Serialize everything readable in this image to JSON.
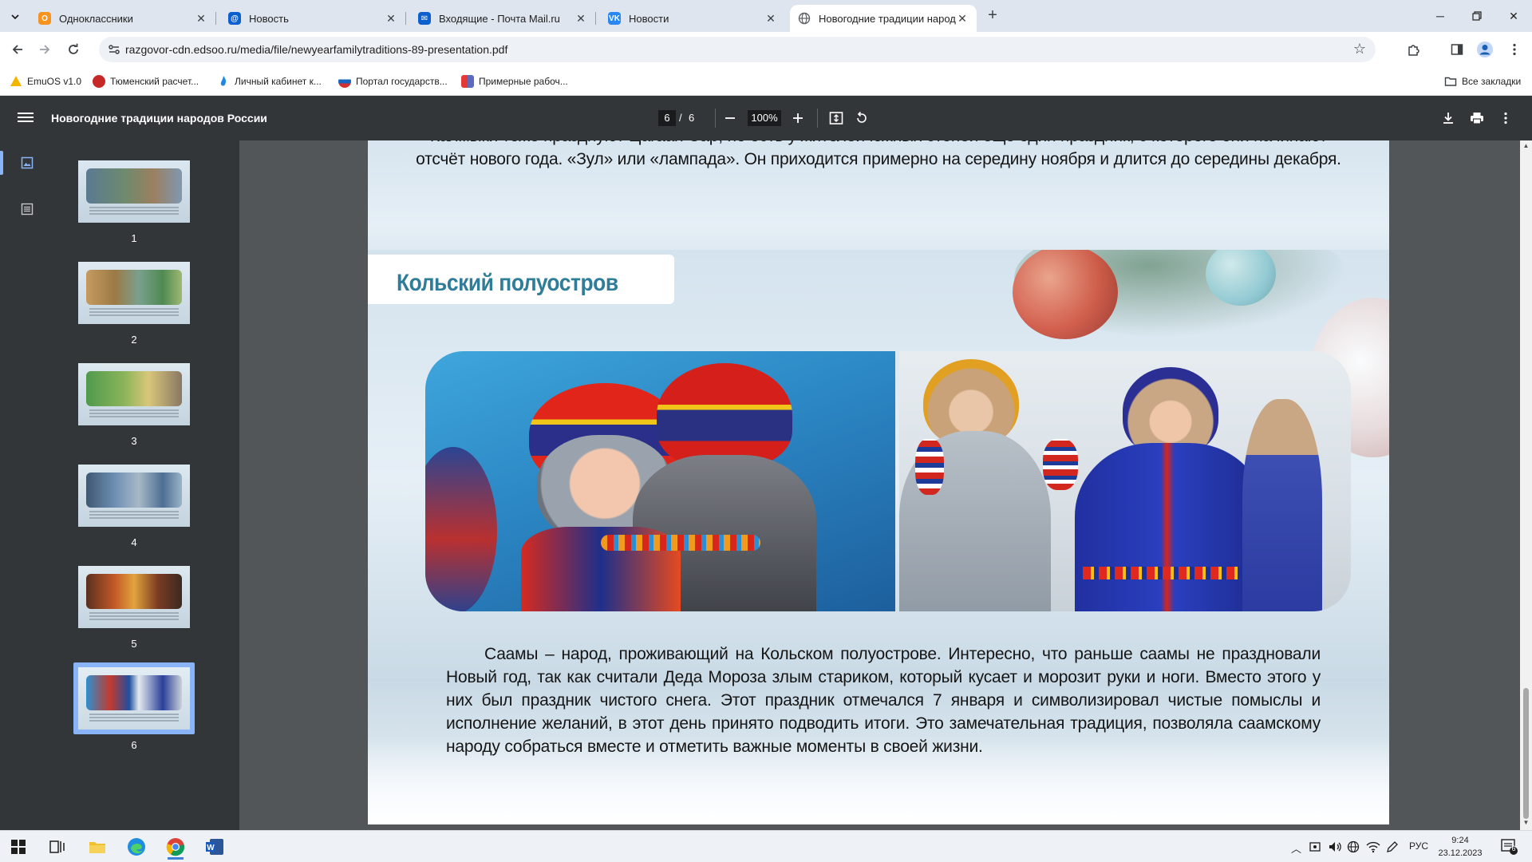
{
  "browser": {
    "tabs": [
      {
        "title": "Одноклассники",
        "favicon": "odnoklassniki-icon",
        "color": "#f7931e",
        "active": false
      },
      {
        "title": "Новость",
        "favicon": "mail-at-icon",
        "color": "#0b5fce",
        "active": false
      },
      {
        "title": "Входящие - Почта Mail.ru",
        "favicon": "mail-envelope-icon",
        "color": "#0b5fce",
        "active": false
      },
      {
        "title": "Новости",
        "favicon": "vk-icon",
        "color": "#2787f5",
        "active": false
      },
      {
        "title": "Новогодние традиции народо",
        "favicon": "globe-icon",
        "color": "#5f6368",
        "active": true
      }
    ],
    "url": "razgovor-cdn.edsoo.ru/media/file/newyearfamilytraditions-89-presentation.pdf",
    "bookmarks": [
      {
        "label": "EmuOS v1.0",
        "color": "#f2b600"
      },
      {
        "label": "Тюменский расчет...",
        "color": "#c62828"
      },
      {
        "label": "Личный кабинет к...",
        "color": "#1e88e5"
      },
      {
        "label": "Портал государств...",
        "color": "#1565c0"
      },
      {
        "label": "Примерные рабоч...",
        "color": "#e53935"
      }
    ],
    "all_bookmarks": "Все закладки"
  },
  "pdf": {
    "title": "Новогодние традиции народов России",
    "current_page": "6",
    "separator": "/",
    "total_pages": "6",
    "zoom": "100%",
    "thumbnails": [
      "1",
      "2",
      "3",
      "4",
      "5",
      "6"
    ],
    "selected_page": 6,
    "prev_page_text_line1": "Калмыки тоже празднуют Цагаан Сар, но есть у жителей южных степей ещё один праздник, с которого они начинают",
    "prev_page_text_line2": "отсчёт нового года. «Зул» или «лампада». Он приходится примерно на середину ноября и длится до середины декабря.",
    "slide_heading": "Кольский полуостров",
    "slide_body": "Саамы – народ, проживающий на Кольском полуострове. Интересно, что раньше саамы не праздновали Новый год, так как считали Деда Мороза злым стариком, который кусает и морозит руки и ноги. Вместо этого у них был праздник чистого снега. Этот праздник отмечался 7 января и символизировал чистые помыслы и исполнение желаний, в этот день принято подводить итоги. Это замечательная традиция, позволяла саамскому народу собраться вместе и отметить важные моменты в своей жизни.",
    "heading_color": "#2f7d99"
  },
  "taskbar": {
    "language": "РУС",
    "time": "9:24",
    "date": "23.12.2023",
    "notification_count": "6"
  }
}
